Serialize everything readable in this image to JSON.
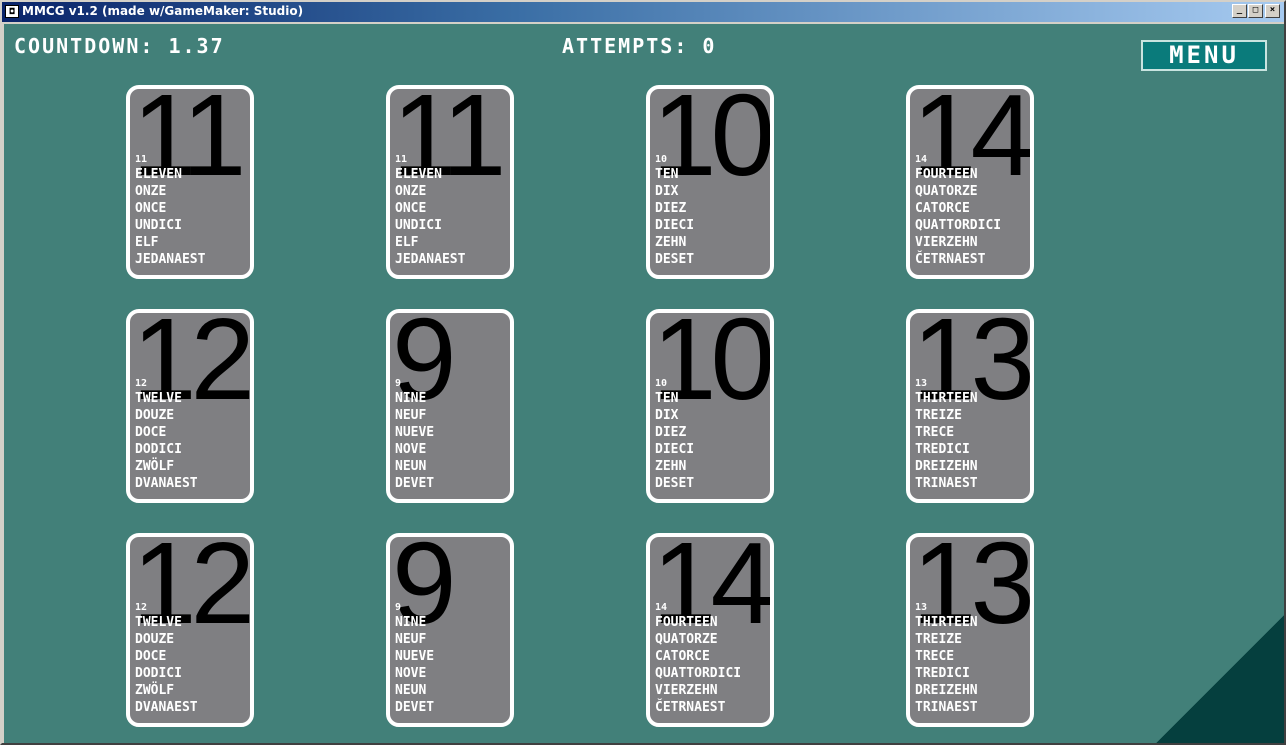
{
  "window": {
    "title": "MMCG v1.2 (made w/GameMaker: Studio)",
    "minimize_label": "_",
    "maximize_label": "□",
    "close_label": "×"
  },
  "hud": {
    "countdown_text": "COUNTDOWN: 1.37",
    "attempts_text": "ATTEMPTS: 0"
  },
  "menu": {
    "label": "MENU"
  },
  "cards": [
    {
      "number": "11",
      "words": [
        "ELEVEN",
        "ONZE",
        "ONCE",
        "UNDICI",
        "ELF",
        "JEDANAEST"
      ]
    },
    {
      "number": "11",
      "words": [
        "ELEVEN",
        "ONZE",
        "ONCE",
        "UNDICI",
        "ELF",
        "JEDANAEST"
      ]
    },
    {
      "number": "10",
      "words": [
        "TEN",
        "DIX",
        "DIEZ",
        "DIECI",
        "ZEHN",
        "DESET"
      ]
    },
    {
      "number": "14",
      "words": [
        "FOURTEEN",
        "QUATORZE",
        "CATORCE",
        "QUATTORDICI",
        "VIERZEHN",
        "ČETRNAEST"
      ]
    },
    {
      "number": "12",
      "words": [
        "TWELVE",
        "DOUZE",
        "DOCE",
        "DODICI",
        "ZWÖLF",
        "DVANAEST"
      ]
    },
    {
      "number": "9",
      "words": [
        "NINE",
        "NEUF",
        "NUEVE",
        "NOVE",
        "NEUN",
        "DEVET"
      ]
    },
    {
      "number": "10",
      "words": [
        "TEN",
        "DIX",
        "DIEZ",
        "DIECI",
        "ZEHN",
        "DESET"
      ]
    },
    {
      "number": "13",
      "words": [
        "THIRTEEN",
        "TREIZE",
        "TRECE",
        "TREDICI",
        "DREIZEHN",
        "TRINAEST"
      ]
    },
    {
      "number": "12",
      "words": [
        "TWELVE",
        "DOUZE",
        "DOCE",
        "DODICI",
        "ZWÖLF",
        "DVANAEST"
      ]
    },
    {
      "number": "9",
      "words": [
        "NINE",
        "NEUF",
        "NUEVE",
        "NOVE",
        "NEUN",
        "DEVET"
      ]
    },
    {
      "number": "14",
      "words": [
        "FOURTEEN",
        "QUATORZE",
        "CATORCE",
        "QUATTORDICI",
        "VIERZEHN",
        "ČETRNAEST"
      ]
    },
    {
      "number": "13",
      "words": [
        "THIRTEEN",
        "TREIZE",
        "TRECE",
        "TREDICI",
        "DREIZEHN",
        "TRINAEST"
      ]
    }
  ]
}
